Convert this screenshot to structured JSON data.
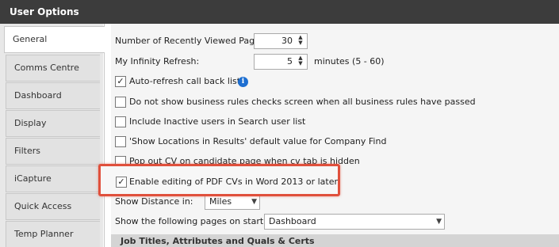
{
  "window": {
    "title": "User Options"
  },
  "sidebar": {
    "tabs": [
      {
        "label": "General",
        "active": true
      },
      {
        "label": "Comms Centre"
      },
      {
        "label": "Dashboard"
      },
      {
        "label": "Display"
      },
      {
        "label": "Filters"
      },
      {
        "label": "iCapture"
      },
      {
        "label": "Quick Access Toolbar"
      },
      {
        "label": "Temp Planner"
      }
    ]
  },
  "general": {
    "recent_pages": {
      "label": "Number of Recently Viewed Pages:",
      "value": "30"
    },
    "refresh": {
      "label": "My Infinity Refresh:",
      "value": "5",
      "suffix": "minutes (5 - 60)"
    },
    "checkboxes": [
      {
        "label": "Auto-refresh call back lists",
        "checked": true
      },
      {
        "label": "Do not show business rules checks screen when all business rules have passed",
        "checked": false
      },
      {
        "label": "Include Inactive users in Search user list",
        "checked": false
      },
      {
        "label": "'Show Locations in Results' default value for Company Find",
        "checked": false
      },
      {
        "label": "Pop out CV on candidate page when cv tab is hidden",
        "checked": false
      },
      {
        "label": "Enable editing of PDF CVs in Word 2013 or later",
        "checked": true
      }
    ],
    "distance": {
      "label": "Show Distance in:",
      "value": "Miles"
    },
    "startup": {
      "label": "Show the following pages on start up:",
      "value": "Dashboard"
    },
    "section_header": "Job Titles, Attributes and Quals & Certs"
  },
  "colors": {
    "titlebar": "#3c3c3c",
    "highlight": "#e0503c",
    "info": "#1e6fd1"
  }
}
